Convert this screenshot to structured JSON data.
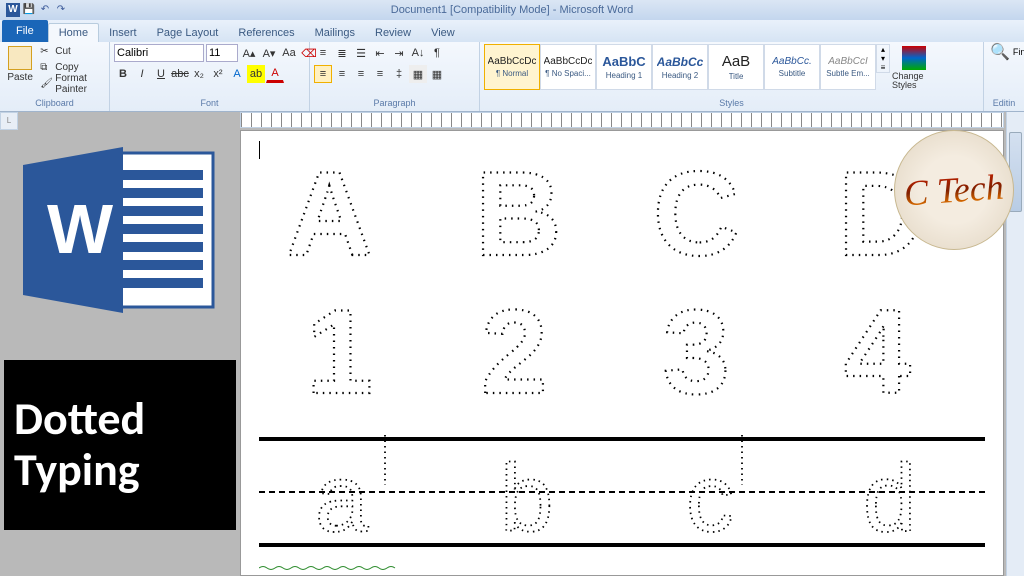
{
  "title": "Document1 [Compatibility Mode] - Microsoft Word",
  "qat": {
    "save": "💾",
    "undo": "↶",
    "redo": "↷"
  },
  "file_tab": "File",
  "tabs": [
    "Home",
    "Insert",
    "Page Layout",
    "References",
    "Mailings",
    "Review",
    "View"
  ],
  "active_tab": "Home",
  "clipboard": {
    "paste": "Paste",
    "cut": "Cut",
    "copy": "Copy",
    "format_painter": "Format Painter",
    "label": "Clipboard"
  },
  "font": {
    "family": "Calibri",
    "size": "11",
    "label": "Font"
  },
  "paragraph": {
    "label": "Paragraph"
  },
  "styles": {
    "label": "Styles",
    "items": [
      {
        "preview": "AaBbCcDc",
        "name": "¶ Normal",
        "selected": true
      },
      {
        "preview": "AaBbCcDc",
        "name": "¶ No Spaci..."
      },
      {
        "preview": "AaBbC",
        "name": "Heading 1"
      },
      {
        "preview": "AaBbCc",
        "name": "Heading 2"
      },
      {
        "preview": "AaB",
        "name": "Title"
      },
      {
        "preview": "AaBbCc.",
        "name": "Subtitle"
      },
      {
        "preview": "AaBbCcI",
        "name": "Subtle Em..."
      }
    ],
    "change": "Change Styles"
  },
  "editing": {
    "find": "Find",
    "label": "Editin"
  },
  "ruler_corner": "L",
  "document": {
    "row1": [
      "A",
      "B",
      "C",
      "D"
    ],
    "row2": [
      "1",
      "2",
      "3",
      "4"
    ],
    "row3": [
      "a",
      "b",
      "c",
      "d"
    ]
  },
  "caption": {
    "line1": "Dotted",
    "line2": "Typing"
  },
  "watermark": "C Tech",
  "colors": {
    "ribbon_blue": "#1a66b8",
    "word_blue": "#2b579a"
  }
}
